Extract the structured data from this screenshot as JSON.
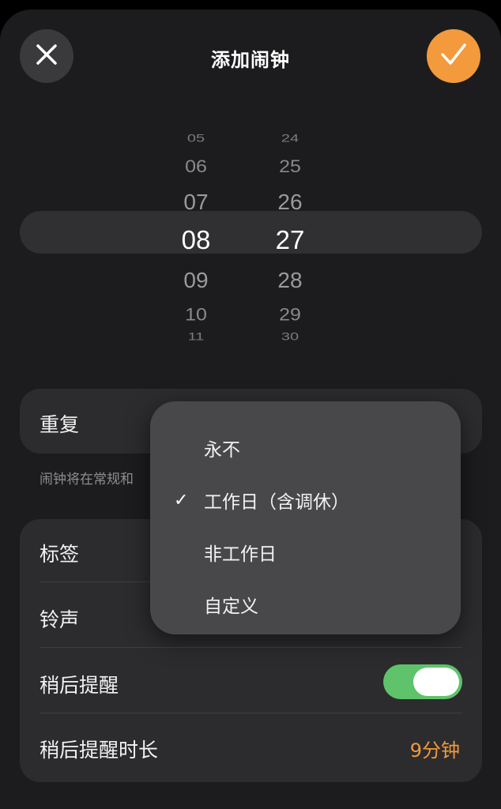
{
  "header": {
    "title": "添加闹钟",
    "close_icon": "close-icon",
    "confirm_icon": "checkmark-icon"
  },
  "picker": {
    "hours": [
      "05",
      "06",
      "07",
      "08",
      "09",
      "10",
      "11"
    ],
    "minutes": [
      "24",
      "25",
      "26",
      "27",
      "28",
      "29",
      "30"
    ],
    "selected_hour": "08",
    "selected_minute": "27"
  },
  "repeat": {
    "label": "重复",
    "hint": "闹钟将在常规和"
  },
  "dropdown": {
    "items": [
      {
        "label": "永不",
        "checked": false
      },
      {
        "label": "工作日（含调休）",
        "checked": true
      },
      {
        "label": "非工作日",
        "checked": false
      },
      {
        "label": "自定义",
        "checked": false
      }
    ]
  },
  "settings": {
    "label_row": "标签",
    "ringtone_row": "铃声",
    "snooze_row": "稍后提醒",
    "snooze_on": true,
    "snooze_duration_row": "稍后提醒时长",
    "snooze_duration_value": "9分钟"
  },
  "colors": {
    "accent": "#f29a3c",
    "toggle_on": "#5ec36a",
    "background": "#1c1c1e"
  }
}
